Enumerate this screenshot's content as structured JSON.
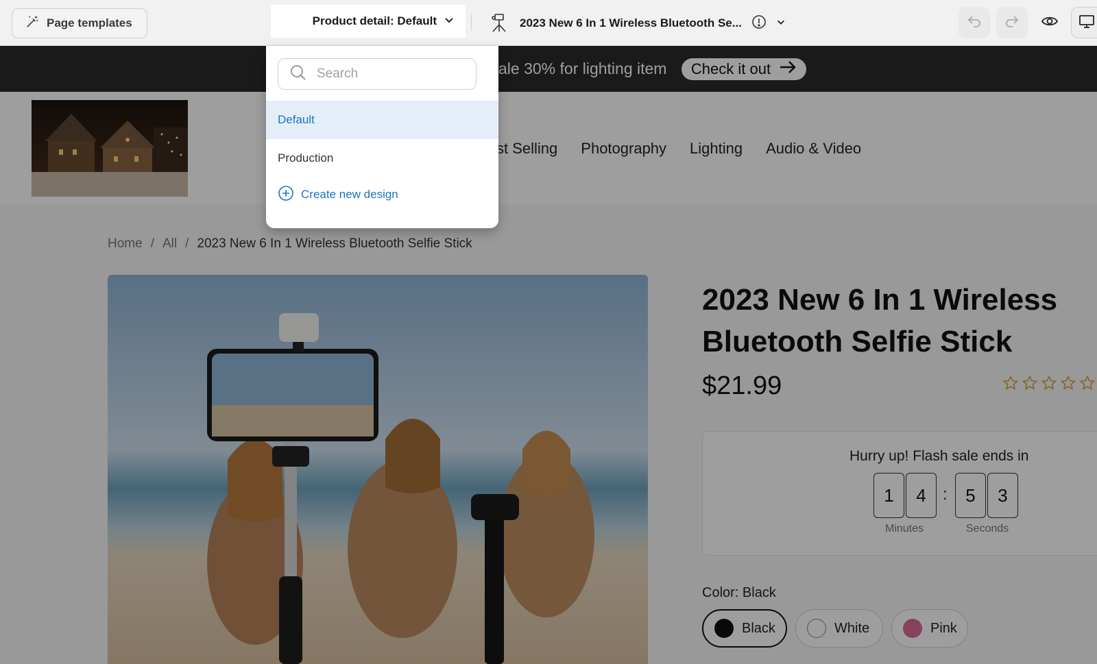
{
  "toolbar": {
    "page_templates_label": "Page templates",
    "design_selector_label": "Product detail: Default",
    "product_name": "2023 New 6 In 1 Wireless Bluetooth Se..."
  },
  "dropdown": {
    "search_placeholder": "Search",
    "items": [
      "Default",
      "Production"
    ],
    "create_label": "Create new design"
  },
  "announcement": {
    "text": "ale 30% for lighting item",
    "cta_label": "Check it out"
  },
  "nav": {
    "items": [
      "st Selling",
      "Photography",
      "Lighting",
      "Audio & Video"
    ]
  },
  "breadcrumb": {
    "items": [
      "Home",
      "All",
      "2023 New 6 In 1 Wireless Bluetooth Selfie Stick"
    ],
    "separator": "/"
  },
  "product": {
    "title": "2023 New 6 In 1 Wireless Bluetooth Selfie Stick",
    "price": "$21.99",
    "rating_stars": 5
  },
  "countdown": {
    "title": "Hurry up! Flash sale ends in",
    "digits": [
      "1",
      "4",
      "5",
      "3"
    ],
    "separator": ":",
    "minutes_label": "Minutes",
    "seconds_label": "Seconds"
  },
  "color_option": {
    "label": "Color: Black",
    "swatches": [
      {
        "name": "Black",
        "color": "#111111"
      },
      {
        "name": "White",
        "color": "#ffffff"
      },
      {
        "name": "Pink",
        "color": "#d86a96"
      }
    ]
  },
  "colors": {
    "accent": "#1b74c4",
    "announcement_bg": "#2b2b2b",
    "star": "#d9a441"
  }
}
